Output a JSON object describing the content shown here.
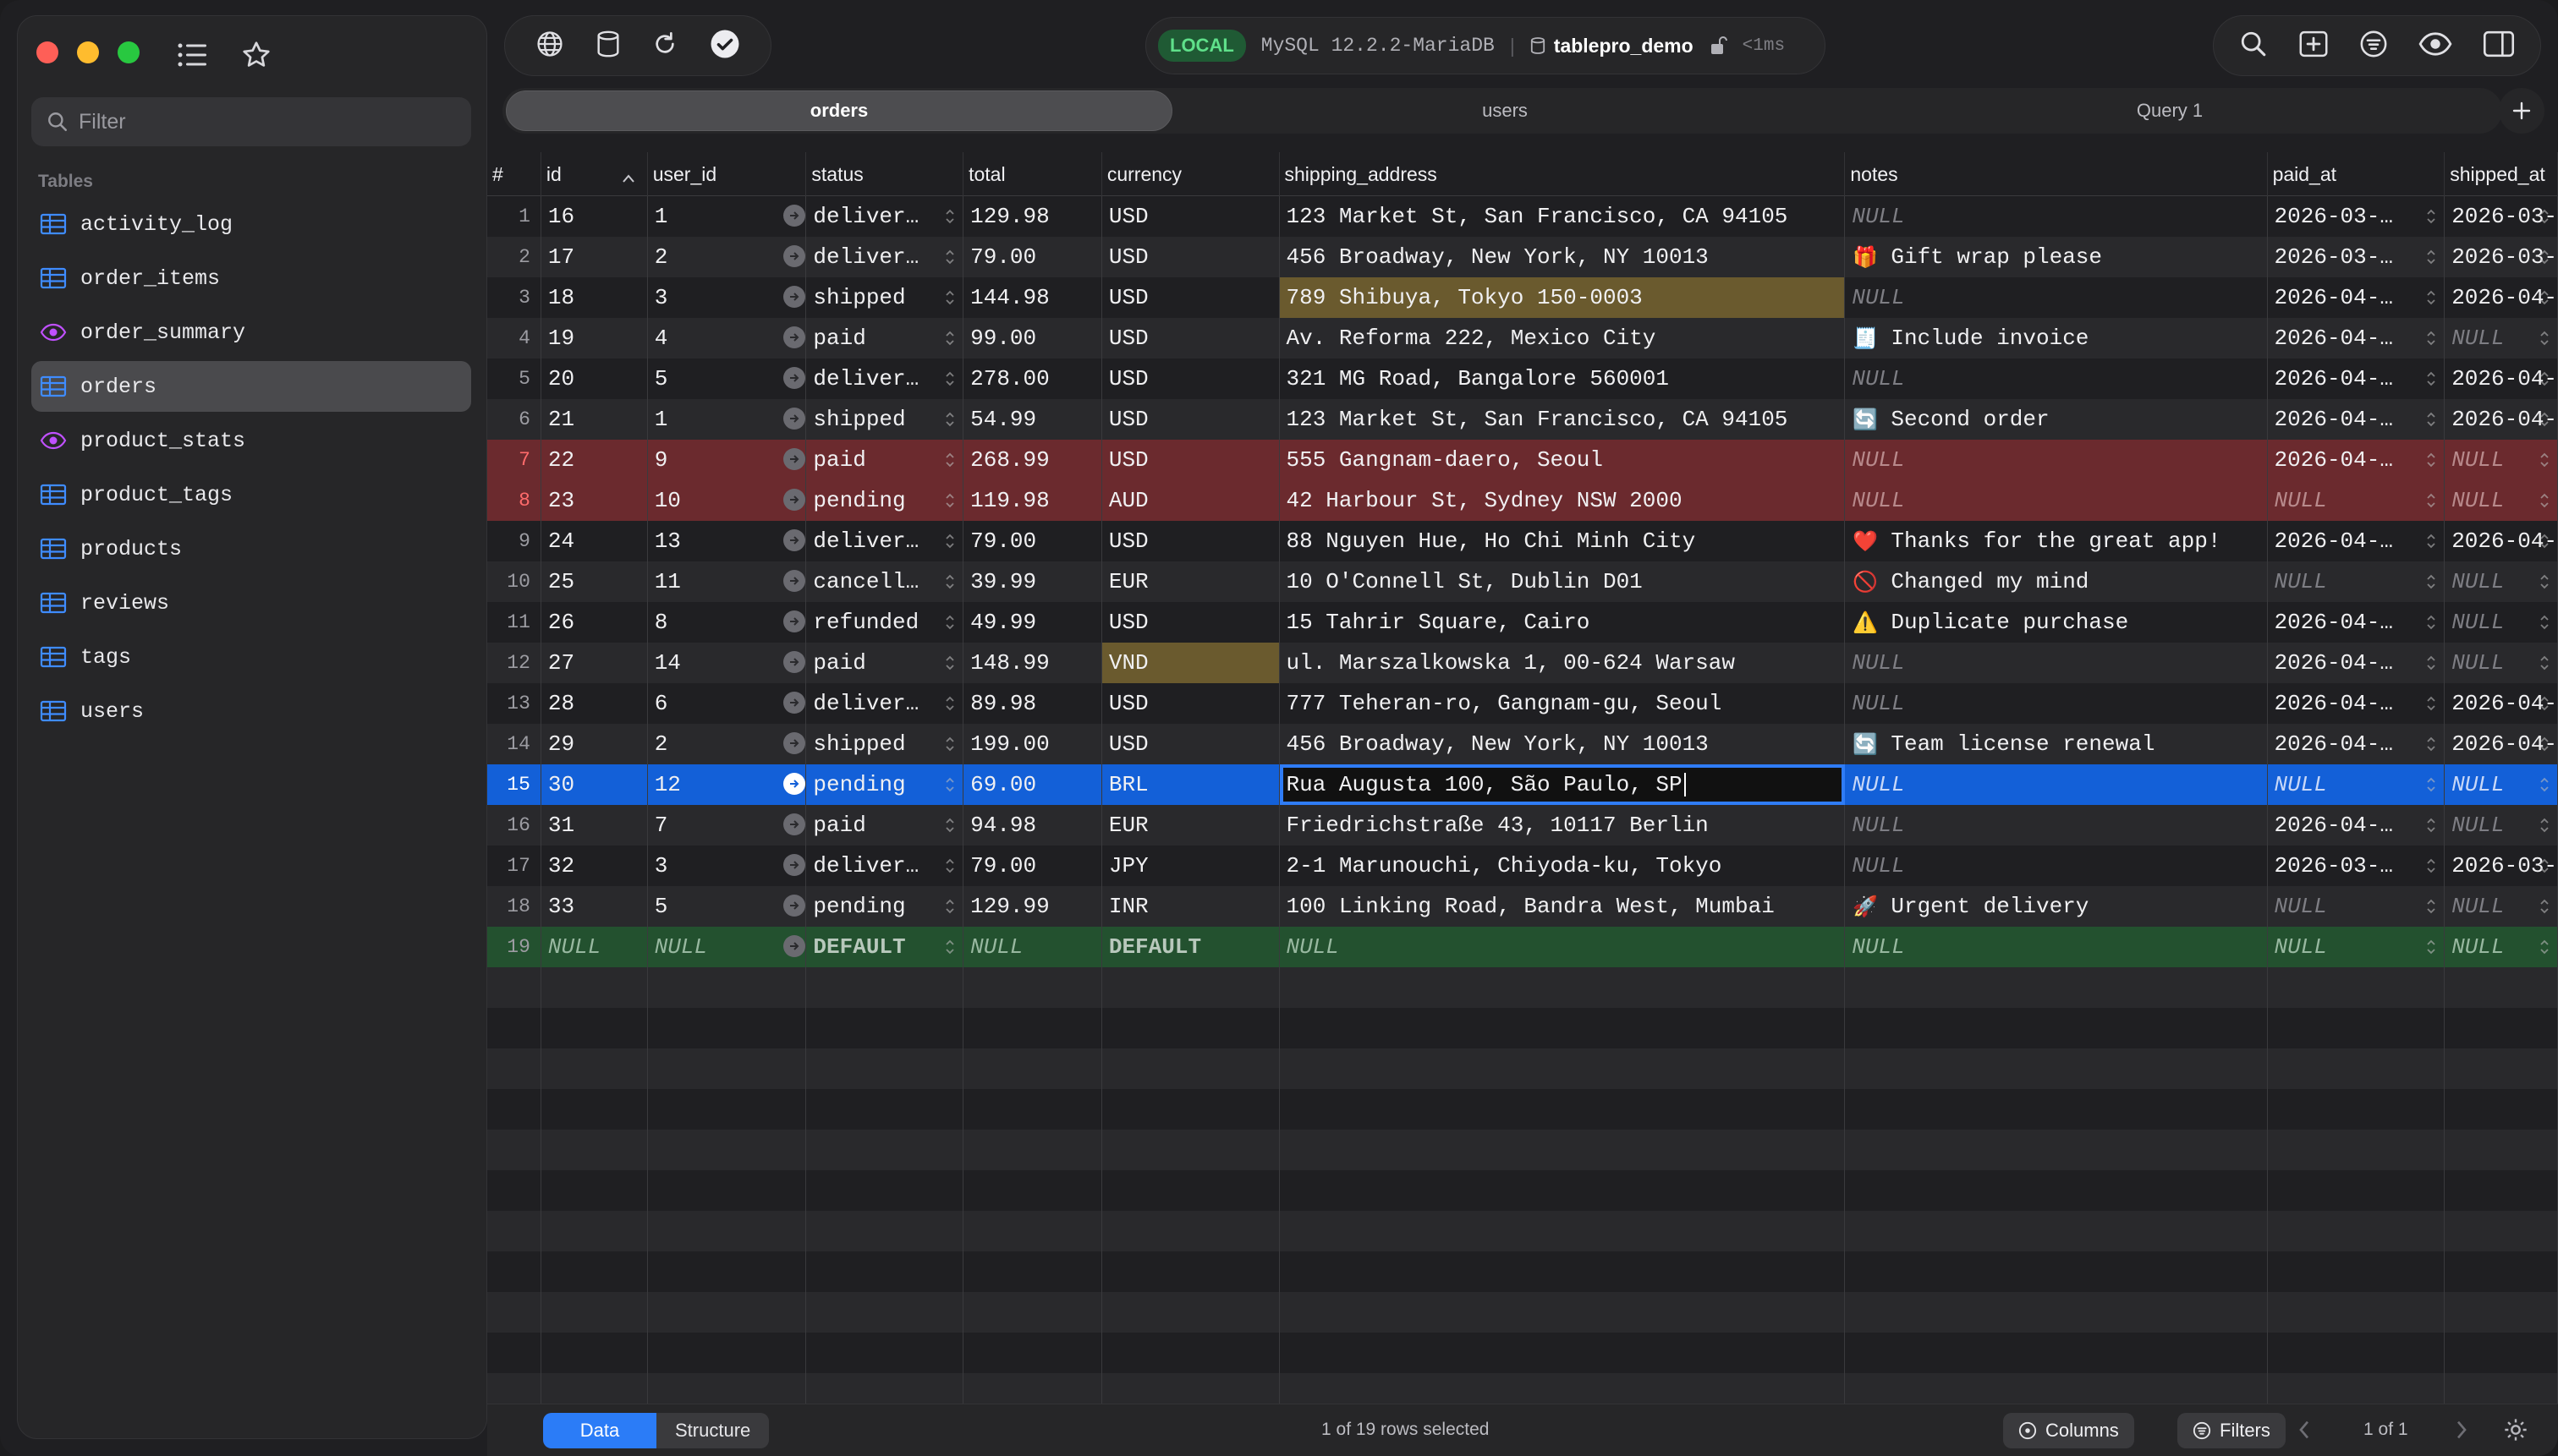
{
  "sidebar": {
    "filter_placeholder": "Filter",
    "section_label": "Tables",
    "items": [
      {
        "label": "activity_log",
        "kind": "table"
      },
      {
        "label": "order_items",
        "kind": "table"
      },
      {
        "label": "order_summary",
        "kind": "view"
      },
      {
        "label": "orders",
        "kind": "table",
        "active": true
      },
      {
        "label": "product_stats",
        "kind": "view"
      },
      {
        "label": "product_tags",
        "kind": "table"
      },
      {
        "label": "products",
        "kind": "table"
      },
      {
        "label": "reviews",
        "kind": "table"
      },
      {
        "label": "tags",
        "kind": "table"
      },
      {
        "label": "users",
        "kind": "table"
      }
    ]
  },
  "connection": {
    "badge": "LOCAL",
    "server": "MySQL 12.2.2-MariaDB",
    "database": "tablepro_demo",
    "latency": "<1ms"
  },
  "tabs": [
    {
      "label": "orders",
      "active": true
    },
    {
      "label": "users"
    },
    {
      "label": "Query 1"
    }
  ],
  "columns": [
    "#",
    "id",
    "user_id",
    "status",
    "total",
    "currency",
    "shipping_address",
    "notes",
    "paid_at",
    "shipped_at"
  ],
  "rows": [
    {
      "n": "1",
      "id": "16",
      "user_id": "1",
      "status": "deliver…",
      "total": "129.98",
      "currency": "USD",
      "addr": "123 Market St, San Francisco, CA 94105",
      "note": "NULL",
      "paid": "2026-03-…",
      "shipped": "2026-03-…"
    },
    {
      "n": "2",
      "id": "17",
      "user_id": "2",
      "status": "deliver…",
      "total": "79.00",
      "currency": "USD",
      "addr": "456 Broadway, New York, NY 10013",
      "note": "Gift wrap please",
      "emoji": "🎁",
      "paid": "2026-03-…",
      "shipped": "2026-03-…"
    },
    {
      "n": "3",
      "id": "18",
      "user_id": "3",
      "status": "shipped",
      "total": "144.98",
      "currency": "USD",
      "addr": "789 Shibuya, Tokyo 150-0003",
      "addr_hl": true,
      "note": "NULL",
      "paid": "2026-04-…",
      "shipped": "2026-04-…"
    },
    {
      "n": "4",
      "id": "19",
      "user_id": "4",
      "status": "paid",
      "total": "99.00",
      "currency": "USD",
      "addr": "Av. Reforma 222, Mexico City",
      "note": "Include invoice",
      "emoji": "🧾",
      "paid": "2026-04-…",
      "shipped": "NULL"
    },
    {
      "n": "5",
      "id": "20",
      "user_id": "5",
      "status": "deliver…",
      "total": "278.00",
      "currency": "USD",
      "addr": "321 MG Road, Bangalore 560001",
      "note": "NULL",
      "paid": "2026-04-…",
      "shipped": "2026-04-…"
    },
    {
      "n": "6",
      "id": "21",
      "user_id": "1",
      "status": "shipped",
      "total": "54.99",
      "currency": "USD",
      "addr": "123 Market St, San Francisco, CA 94105",
      "note": "Second order",
      "emoji": "🔄",
      "paid": "2026-04-…",
      "shipped": "2026-04-…"
    },
    {
      "n": "7",
      "id": "22",
      "user_id": "9",
      "status": "paid",
      "total": "268.99",
      "currency": "USD",
      "addr": "555 Gangnam-daero, Seoul",
      "note": "NULL",
      "paid": "2026-04-…",
      "shipped": "NULL",
      "style": "red"
    },
    {
      "n": "8",
      "id": "23",
      "user_id": "10",
      "status": "pending",
      "total": "119.98",
      "currency": "AUD",
      "addr": "42 Harbour St, Sydney NSW 2000",
      "note": "NULL",
      "paid": "NULL",
      "shipped": "NULL",
      "style": "red"
    },
    {
      "n": "9",
      "id": "24",
      "user_id": "13",
      "status": "deliver…",
      "total": "79.00",
      "currency": "USD",
      "addr": "88 Nguyen Hue, Ho Chi Minh City",
      "note": "Thanks for the great app!",
      "emoji": "❤️",
      "paid": "2026-04-…",
      "shipped": "2026-04-…"
    },
    {
      "n": "10",
      "id": "25",
      "user_id": "11",
      "status": "cancell…",
      "total": "39.99",
      "currency": "EUR",
      "addr": "10 O'Connell St, Dublin D01",
      "note": "Changed my mind",
      "emoji": "🚫",
      "paid": "NULL",
      "shipped": "NULL"
    },
    {
      "n": "11",
      "id": "26",
      "user_id": "8",
      "status": "refunded",
      "total": "49.99",
      "currency": "USD",
      "addr": "15 Tahrir Square, Cairo",
      "note": "Duplicate purchase",
      "emoji": "⚠️",
      "paid": "2026-04-…",
      "shipped": "NULL"
    },
    {
      "n": "12",
      "id": "27",
      "user_id": "14",
      "status": "paid",
      "total": "148.99",
      "currency": "VND",
      "currency_hl": true,
      "addr": "ul. Marszalkowska 1, 00-624 Warsaw",
      "note": "NULL",
      "paid": "2026-04-…",
      "shipped": "NULL"
    },
    {
      "n": "13",
      "id": "28",
      "user_id": "6",
      "status": "deliver…",
      "total": "89.98",
      "currency": "USD",
      "addr": "777 Teheran-ro, Gangnam-gu, Seoul",
      "note": "NULL",
      "paid": "2026-04-…",
      "shipped": "2026-04-…"
    },
    {
      "n": "14",
      "id": "29",
      "user_id": "2",
      "status": "shipped",
      "total": "199.00",
      "currency": "USD",
      "addr": "456 Broadway, New York, NY 10013",
      "note": "Team license renewal",
      "emoji": "🔄",
      "paid": "2026-04-…",
      "shipped": "2026-04-…"
    },
    {
      "n": "15",
      "id": "30",
      "user_id": "12",
      "status": "pending",
      "total": "69.00",
      "currency": "BRL",
      "addr": "Rua Augusta 100, São Paulo, SP",
      "addr_edit": true,
      "note": "NULL",
      "paid": "NULL",
      "shipped": "NULL",
      "style": "sel"
    },
    {
      "n": "16",
      "id": "31",
      "user_id": "7",
      "status": "paid",
      "total": "94.98",
      "currency": "EUR",
      "addr": "Friedrichstraße 43, 10117 Berlin",
      "note": "NULL",
      "paid": "2026-04-…",
      "shipped": "NULL"
    },
    {
      "n": "17",
      "id": "32",
      "user_id": "3",
      "status": "deliver…",
      "total": "79.00",
      "currency": "JPY",
      "addr": "2-1 Marunouchi, Chiyoda-ku, Tokyo",
      "note": "NULL",
      "paid": "2026-03-…",
      "shipped": "2026-03-…"
    },
    {
      "n": "18",
      "id": "33",
      "user_id": "5",
      "status": "pending",
      "total": "129.99",
      "currency": "INR",
      "addr": "100 Linking Road, Bandra West, Mumbai",
      "note": "Urgent delivery",
      "emoji": "🚀",
      "paid": "NULL",
      "shipped": "NULL"
    },
    {
      "n": "19",
      "id": "NULL",
      "user_id": "NULL",
      "status": "DEFAULT",
      "total": "NULL",
      "currency": "DEFAULT",
      "addr": "NULL",
      "note": "NULL",
      "paid": "NULL",
      "shipped": "NULL",
      "style": "green"
    }
  ],
  "empty_rows": 11,
  "bottom": {
    "data_label": "Data",
    "structure_label": "Structure",
    "status": "1 of 19 rows selected",
    "columns_label": "Columns",
    "filters_label": "Filters",
    "pager": "1 of 1"
  },
  "colors": {
    "accent": "#1360d8",
    "red_row": "#6b2a2e",
    "new_row": "#23512f",
    "local_badge": "#1f5a34"
  }
}
